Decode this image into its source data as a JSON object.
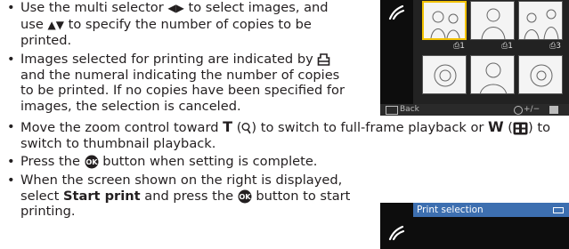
{
  "bullets": [
    {
      "lines": [
        [
          "Use the multi selector ",
          "",
          " to select images, and"
        ],
        [
          "use ",
          "",
          " to specify the number of copies to be"
        ],
        [
          "printed."
        ]
      ],
      "arrows_lr": "◀▶",
      "arrows_ud": "▲▼"
    },
    {
      "line1_a": "Images selected for printing are indicated by ",
      "line2": "and the numeral indicating the number of copies",
      "line3": "to be printed. If no copies have been specified for",
      "line4": "images, the selection is canceled."
    },
    {
      "line1_a": "Move the zoom control toward ",
      "T": "T",
      "line1_b": " (",
      "line1_c": ") to switch to full-frame playback or ",
      "W": "W",
      "line1_d": " (",
      "line1_e": ") to",
      "line2": "switch to thumbnail playback."
    },
    {
      "a": "Press the ",
      "b": " button when setting is complete."
    },
    {
      "line1": "When the screen shown on the right is displayed,",
      "line2_a": "select ",
      "line2_bold": "Start print",
      "line2_b": " and press the ",
      "line2_c": " button to start",
      "line3": "printing."
    }
  ],
  "ok_label": "OK",
  "screen1": {
    "copies": [
      "1",
      "1",
      "3"
    ],
    "back_label": "Back",
    "adjust_label": "+/−"
  },
  "screen2": {
    "title": "Print selection"
  },
  "colors": {
    "text": "#231f20",
    "screen_bg": "#0d0d0d",
    "title_bar": "#3d6fb0",
    "selection": "#f2c200"
  }
}
